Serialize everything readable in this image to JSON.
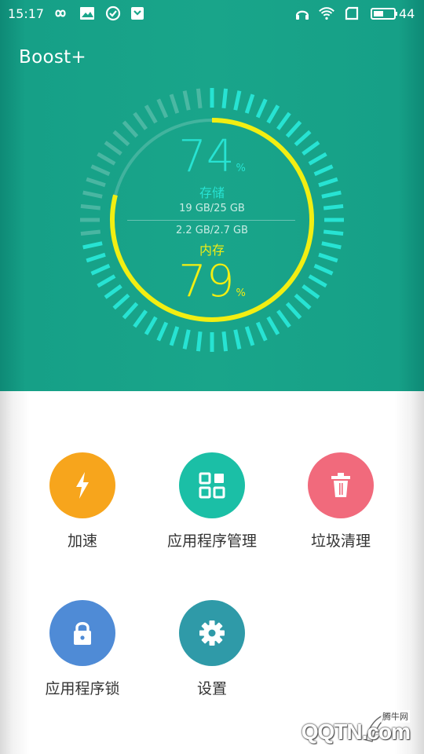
{
  "status_bar": {
    "time": "15:17",
    "battery": "44",
    "icons_left": [
      "infinity-icon",
      "image-icon",
      "check-circle-icon",
      "shield-icon"
    ],
    "icons_right": [
      "headset-icon",
      "wifi-icon",
      "sim-icon",
      "battery-icon"
    ]
  },
  "app": {
    "title": "Boost+"
  },
  "gauge": {
    "storage": {
      "percent": "74",
      "percent_sign": "%",
      "label": "存储",
      "usage": "19 GB/25 GB",
      "color": "#27e3d3"
    },
    "memory": {
      "percent": "79",
      "percent_sign": "%",
      "label": "内存",
      "usage": "2.2 GB/2.7 GB",
      "color": "#f2ee12"
    },
    "storage_fraction": 0.74,
    "memory_fraction": 0.79
  },
  "tiles": [
    {
      "label": "加速",
      "icon": "lightning-icon",
      "color": "#f7a51c"
    },
    {
      "label": "应用程序管理",
      "icon": "grid-icon",
      "color": "#1bbfa6"
    },
    {
      "label": "垃圾清理",
      "icon": "trash-icon",
      "color": "#f16a7c"
    },
    {
      "label": "应用程序锁",
      "icon": "lock-icon",
      "color": "#4f8bd6"
    },
    {
      "label": "设置",
      "icon": "gear-icon",
      "color": "#2f9aa8"
    }
  ],
  "watermark": {
    "small": "腾牛网",
    "brand": "QQTN.com"
  }
}
